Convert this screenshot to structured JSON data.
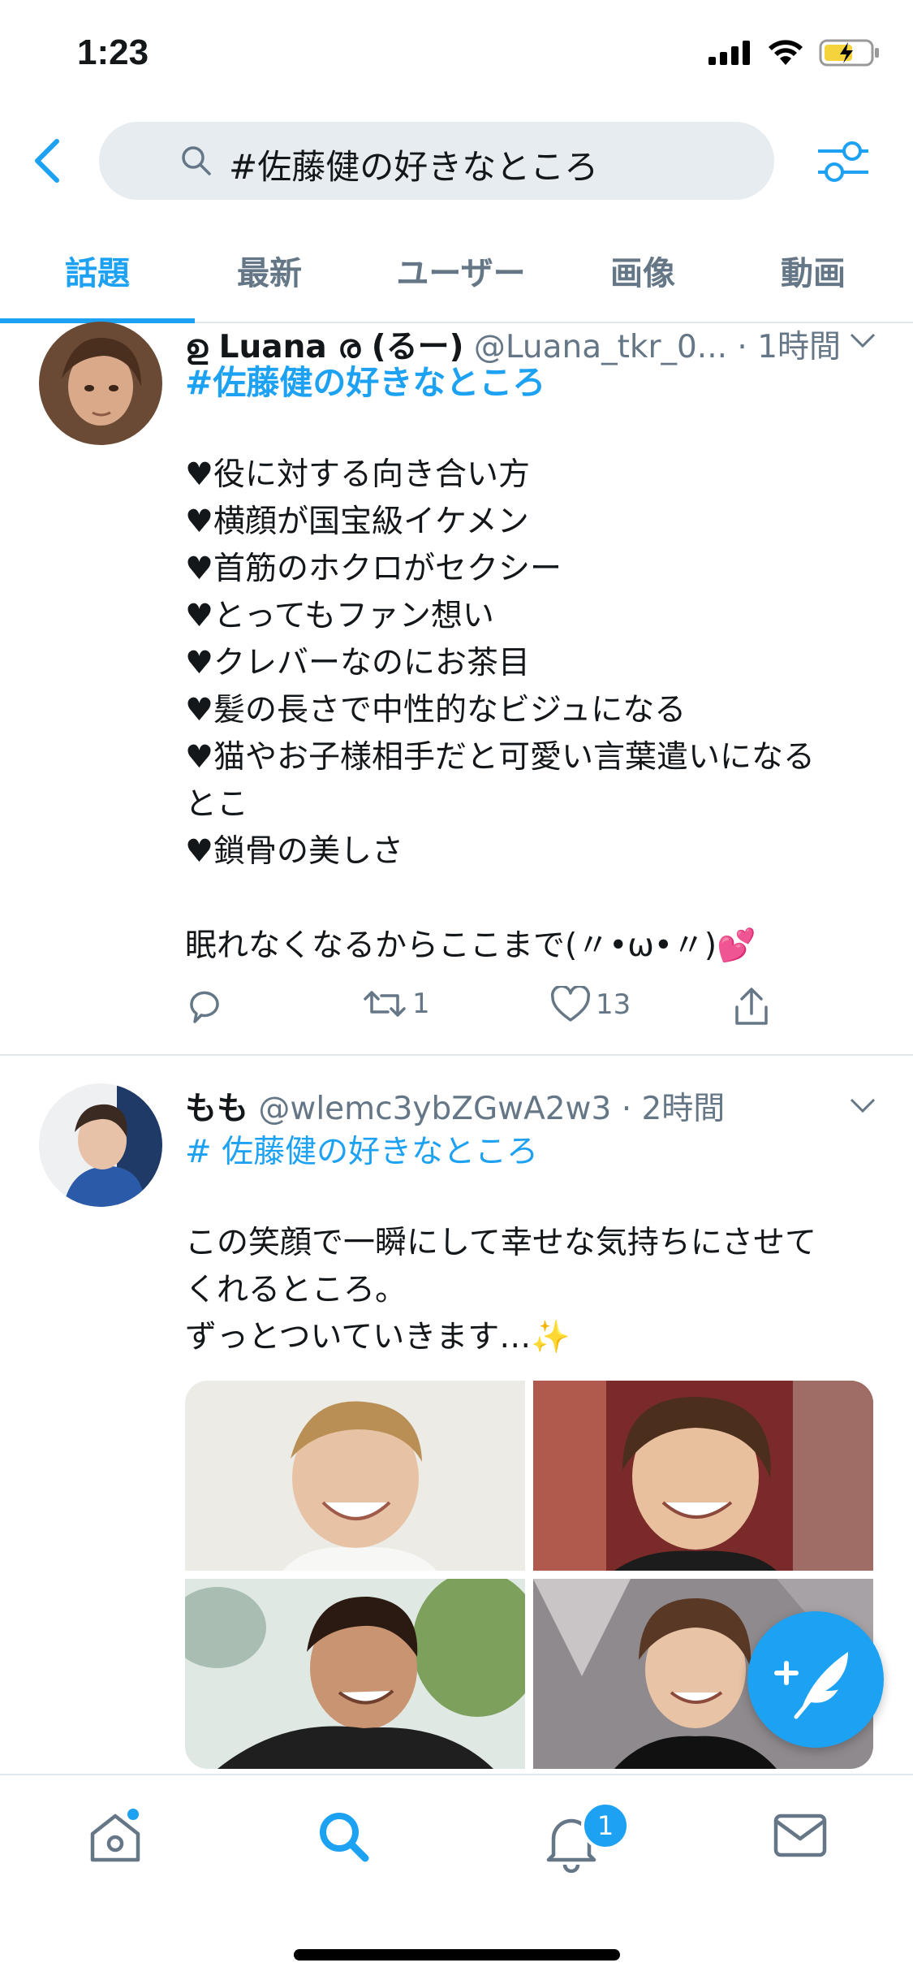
{
  "status_bar": {
    "time": "1:23"
  },
  "search": {
    "query": "#佐藤健の好きなところ"
  },
  "tabs": [
    {
      "label": "話題"
    },
    {
      "label": "最新"
    },
    {
      "label": "ユーザー"
    },
    {
      "label": "画像"
    },
    {
      "label": "動画"
    }
  ],
  "tweets": [
    {
      "name": "ഉ Luana ര (るー)",
      "handle": "@Luana_tkr_0...",
      "time": "· 1時間",
      "hashtag": "#佐藤健の好きなところ",
      "body": "♥役に対する向き合い方\n♥横顔が国宝級イケメン\n♥首筋のホクロがセクシー\n♥とってもファン想い\n♥クレバーなのにお茶目\n♥髪の長さで中性的なビジュになる\n♥猫やお子様相手だと可愛い言葉遣いになる\nとこ\n♥鎖骨の美しさ\n\n眠れなくなるからここまで(〃•ω•〃)💕",
      "retweets": "1",
      "likes": "13"
    },
    {
      "name": "もも",
      "handle": "@wlemc3ybZGwA2w3",
      "time": "· 2時間",
      "hashtag": "# 佐藤健の好きなところ",
      "body": "この笑顔で一瞬にして幸せな気持ちにさせて\nくれるところ。\nずっとついていきます…✨"
    }
  ],
  "notifications_badge": "1",
  "colors": {
    "accent": "#1da1f2",
    "secondary_text": "#657786"
  }
}
